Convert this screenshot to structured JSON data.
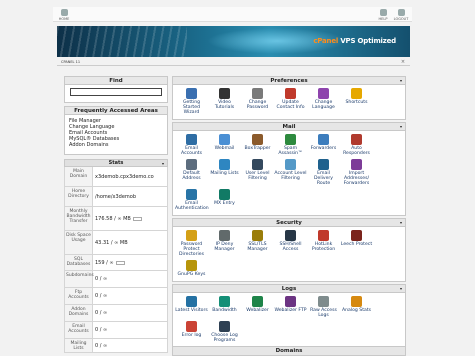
{
  "toolbar": {
    "home_label": "HOME",
    "help_label": "HELP",
    "logout_label": "LOGOUT"
  },
  "banner": {
    "brand": "cPanel",
    "tagline": "VPS Optimized"
  },
  "crumb": "CPANEL 11",
  "find": {
    "title": "Find",
    "value": ""
  },
  "faa": {
    "title": "Frequently Accessed Areas",
    "items": [
      "File Manager",
      "Change Language",
      "Email Accounts",
      "MySQL® Databases",
      "Addon Domains"
    ]
  },
  "stats": {
    "title": "Stats",
    "rows": [
      {
        "label": "Main Domain",
        "value": "x3demob.cpx3demo.co"
      },
      {
        "label": "Home Directory",
        "value": "/home/x3demob"
      },
      {
        "label": "Monthly Bandwidth Transfer",
        "value": "176.58 / ∞ MB"
      },
      {
        "label": "Disk Space Usage",
        "value": "43.31 / ∞ MB"
      },
      {
        "label": "SQL Databases",
        "value": "159 / ∞"
      },
      {
        "label": "Subdomains",
        "value": "0 / ∞"
      },
      {
        "label": "Ftp Accounts",
        "value": "0 / ∞"
      },
      {
        "label": "Addon Domains",
        "value": "0 / ∞"
      },
      {
        "label": "Email Accounts",
        "value": "0 / ∞"
      },
      {
        "label": "Mailing Lists",
        "value": "0 / ∞"
      }
    ]
  },
  "sections": {
    "preferences": {
      "title": "Preferences",
      "items": [
        {
          "label": "Getting Started Wizard",
          "icon": "wizard-icon",
          "color": "#3a6fb0"
        },
        {
          "label": "Video Tutorials",
          "icon": "video-icon",
          "color": "#333333"
        },
        {
          "label": "Change Password",
          "icon": "password-icon",
          "color": "#7a7a7a"
        },
        {
          "label": "Update Contact Info",
          "icon": "contact-icon",
          "color": "#c0392b"
        },
        {
          "label": "Change Language",
          "icon": "language-icon",
          "color": "#8e44ad"
        },
        {
          "label": "Shortcuts",
          "icon": "star-icon",
          "color": "#e6a800"
        }
      ]
    },
    "mail": {
      "title": "Mail",
      "items": [
        {
          "label": "Email Accounts",
          "icon": "mail-icon",
          "color": "#2e6da4"
        },
        {
          "label": "Webmail",
          "icon": "webmail-icon",
          "color": "#4a8fd4"
        },
        {
          "label": "BoxTrapper",
          "icon": "boxtrapper-icon",
          "color": "#8b5a2b"
        },
        {
          "label": "Spam Assassin™",
          "icon": "spam-icon",
          "color": "#2d8a3e"
        },
        {
          "label": "Forwarders",
          "icon": "forwarders-icon",
          "color": "#3c7dbd"
        },
        {
          "label": "Auto Responders",
          "icon": "autoresponder-icon",
          "color": "#b03a2e"
        },
        {
          "label": "Default Address",
          "icon": "default-address-icon",
          "color": "#5d6d7e"
        },
        {
          "label": "Mailing Lists",
          "icon": "mailing-list-icon",
          "color": "#2e86c1"
        },
        {
          "label": "User Level Filtering",
          "icon": "user-filter-icon",
          "color": "#34495e"
        },
        {
          "label": "Account Level Filtering",
          "icon": "account-filter-icon",
          "color": "#5499c7"
        },
        {
          "label": "Email Delivery Route",
          "icon": "delivery-route-icon",
          "color": "#1f618d"
        },
        {
          "label": "Import Addresses/ Forwarders",
          "icon": "import-icon",
          "color": "#7d3c98"
        },
        {
          "label": "Email Authentication",
          "icon": "mail-auth-icon",
          "color": "#2874a6"
        },
        {
          "label": "MX Entry",
          "icon": "mx-entry-icon",
          "color": "#117a65"
        }
      ]
    },
    "security": {
      "title": "Security",
      "items": [
        {
          "label": "Password Protect Directories",
          "icon": "folder-lock-icon",
          "color": "#d4a017"
        },
        {
          "label": "IP Deny Manager",
          "icon": "ip-deny-icon",
          "color": "#616a6b"
        },
        {
          "label": "SSL/TLS Manager",
          "icon": "ssl-icon",
          "color": "#9a7d0a"
        },
        {
          "label": "SSH/Shell Access",
          "icon": "ssh-icon",
          "color": "#273746"
        },
        {
          "label": "HotLink Protection",
          "icon": "hotlink-icon",
          "color": "#c0392b"
        },
        {
          "label": "Leech Protect",
          "icon": "leech-icon",
          "color": "#7b241c"
        },
        {
          "label": "GnuPG Keys",
          "icon": "key-icon",
          "color": "#b7950b"
        }
      ]
    },
    "logs": {
      "title": "Logs",
      "items": [
        {
          "label": "Latest Visitors",
          "icon": "visitors-icon",
          "color": "#2471a3"
        },
        {
          "label": "Bandwidth",
          "icon": "bandwidth-icon",
          "color": "#148f77"
        },
        {
          "label": "Webalizer",
          "icon": "webalizer-icon",
          "color": "#1e8449"
        },
        {
          "label": "Webalizer FTP",
          "icon": "webalizer-ftp-icon",
          "color": "#6c3483"
        },
        {
          "label": "Raw Access Logs",
          "icon": "raw-logs-icon",
          "color": "#7f8c8d"
        },
        {
          "label": "Analog Stats",
          "icon": "analog-icon",
          "color": "#d68910"
        },
        {
          "label": "Error log",
          "icon": "error-log-icon",
          "color": "#cb4335"
        },
        {
          "label": "Choose Log Programs",
          "icon": "log-programs-icon",
          "color": "#2e4053"
        }
      ]
    },
    "domains": {
      "title": "Domains"
    }
  }
}
